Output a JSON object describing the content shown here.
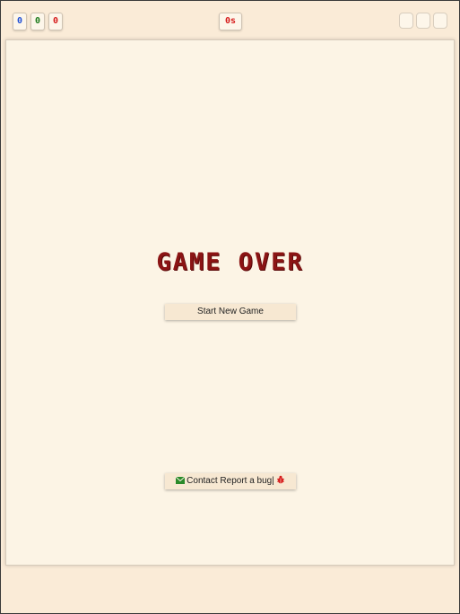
{
  "topbar": {
    "counters": [
      {
        "value": "0",
        "color": "#1f4fd6"
      },
      {
        "value": "0",
        "color": "#1a7a1a"
      },
      {
        "value": "0",
        "color": "#d61a1a"
      }
    ],
    "timer": {
      "value": "0s",
      "color": "#d61a1a"
    }
  },
  "main": {
    "title": "GAME OVER",
    "title_color": "#8b1414",
    "new_game_label": "Start New Game",
    "contact_label": "Contact",
    "report_label": "Report a bug",
    "separator": "|",
    "icons": {
      "contact": "envelope-icon",
      "report": "bug-icon"
    },
    "icon_colors": {
      "envelope": "#2a8a2a",
      "bug": "#d61a1a"
    }
  }
}
